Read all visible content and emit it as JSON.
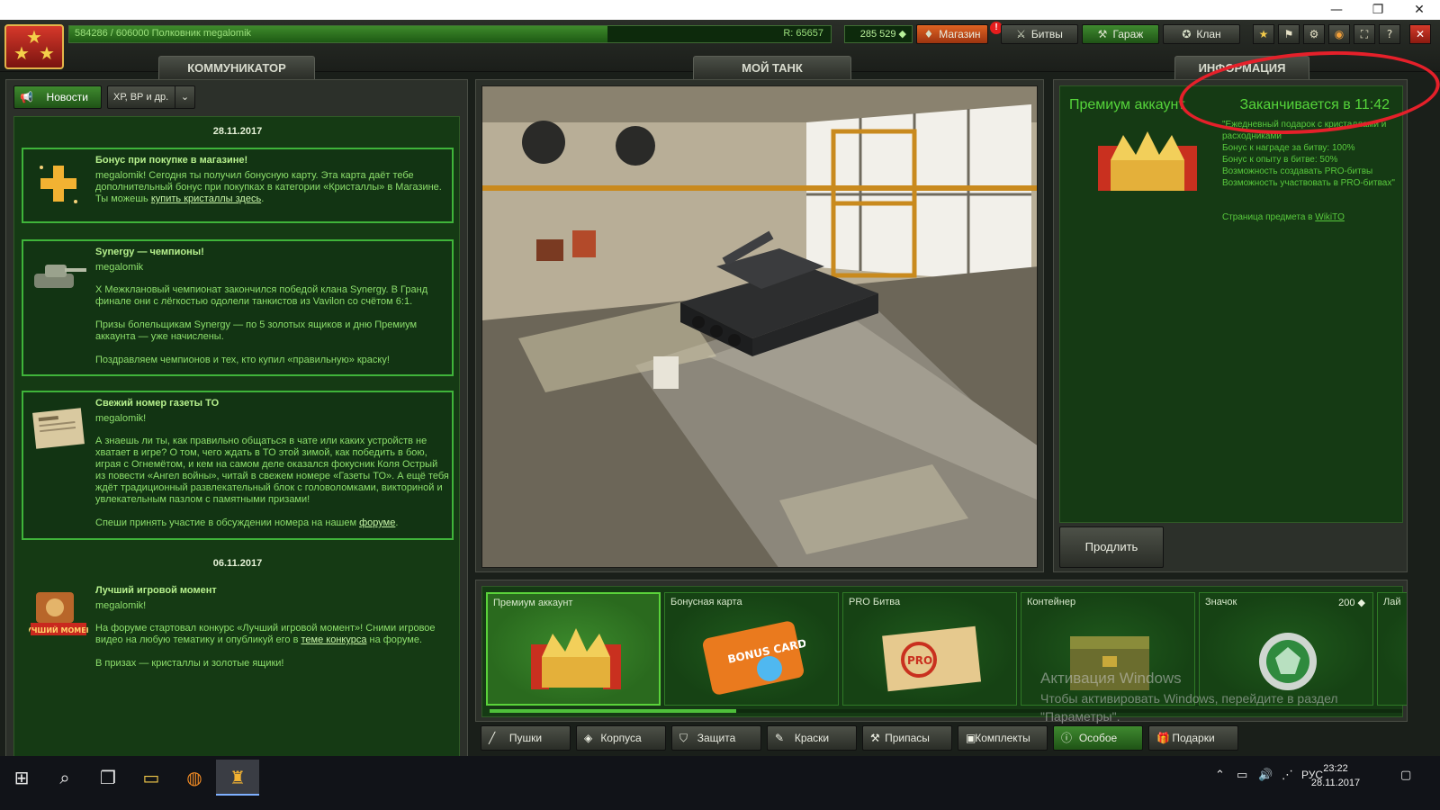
{
  "window": {
    "minimize": "—",
    "restore": "❐",
    "close": "✕"
  },
  "topbar": {
    "xp_text": "584286 / 606000  Полковник megalomik",
    "xp_progress": 0.964,
    "rating": "R: 65657",
    "crystals": "285 529 ◆",
    "shop_label": "Магазин",
    "shop_badge": "!",
    "battles_label": "Битвы",
    "garage_label": "Гараж",
    "clan_label": "Клан"
  },
  "tabs": {
    "communicator": "КОММУНИКАТОР",
    "my_tank": "МОЙ ТАНК",
    "info": "ИНФОРМАЦИЯ"
  },
  "left": {
    "news_btn": "Новости",
    "filter_btn": "ХР, ВР и др.",
    "date1": "28.11.2017",
    "date2": "06.11.2017",
    "news": [
      {
        "title": "Бонус при покупке в магазине!",
        "text1": "megalomik! Сегодня ты получил бонусную карту. Эта карта даёт тебе дополнительный бонус при покупках в категории «Кристаллы» в Магазине. Ты можешь ",
        "link": "купить кристаллы здесь",
        "text2": "."
      },
      {
        "title": "Synergy — чемпионы!",
        "author": "megalomik",
        "p1": "X Межклановый чемпионат закончился победой клана Synergy. В Гранд финале они с лёгкостью одолели танкистов из Vavilon со счётом 6:1.",
        "p2": "Призы болельщикам Synergy — по 5 золотых ящиков и дню Премиум аккаунта — уже начислены.",
        "p3": "Поздравляем чемпионов и тех, кто купил «правильную» краску!"
      },
      {
        "title": "Свежий номер газеты ТО",
        "author": "megalomik!",
        "p1": "А знаешь ли ты, как правильно общаться в чате или каких устройств не хватает в игре? О том, чего ждать в ТО этой зимой, как победить в бою, играя с Огнемётом, и кем на самом деле оказался фокусник Коля Острый из повести «Ангел войны», читай в свежем номере «Газеты ТО». А ещё тебя ждёт традиционный развлекательный блок с головоломками, викториной и увлекательным пазлом с памятными призами!",
        "p2a": "Спеши принять участие в обсуждении номера на нашем ",
        "link": "форуме",
        "p2b": "."
      },
      {
        "title": "Лучший игровой момент",
        "author": "megalomik!",
        "p1a": "На форуме стартовал конкурс «Лучший игровой момент»! Сними игровое видео на любую тематику и опубликуй его в ",
        "link": "теме конкурса",
        "p1b": " на форуме.",
        "p2": "В призах — кристаллы и золотые ящики!",
        "badge": "ЛУЧШИЙ МОМЕНТ"
      }
    ]
  },
  "info": {
    "title": "Премиум аккаунт",
    "expire": "Заканчивается в 11:42",
    "desc": "\"Ежедневный подарок с кристаллами и расходниками\nБонус к награде за битву: 100%\nБонус к опыту в битве: 50%\nВозможность создавать PRO-битвы\nВозможность участвовать в PRO-битвах\"",
    "wiki_prefix": "Страница предмета в ",
    "wiki_link": "WikiTO",
    "renew": "Продлить"
  },
  "shop": {
    "items": [
      {
        "label": "Премиум аккаунт"
      },
      {
        "label": "Бонусная карта",
        "card_text": "BONUS CARD"
      },
      {
        "label": "PRO Битва",
        "stamp_text": "PRO"
      },
      {
        "label": "Контейнер"
      },
      {
        "label": "Значок",
        "price": "200 ◆"
      },
      {
        "label": "Лай"
      }
    ],
    "scroll_fraction": 0.27
  },
  "categories": [
    "Пушки",
    "Корпуса",
    "Защита",
    "Краски",
    "Припасы",
    "Комплекты",
    "Особое",
    "Подарки"
  ],
  "watermark": {
    "line1": "Активация Windows",
    "line2": "Чтобы активировать Windows, перейдите в раздел \"Параметры\"."
  },
  "taskbar": {
    "lang": "РУС",
    "time": "23:22",
    "date": "28.11.2017"
  }
}
